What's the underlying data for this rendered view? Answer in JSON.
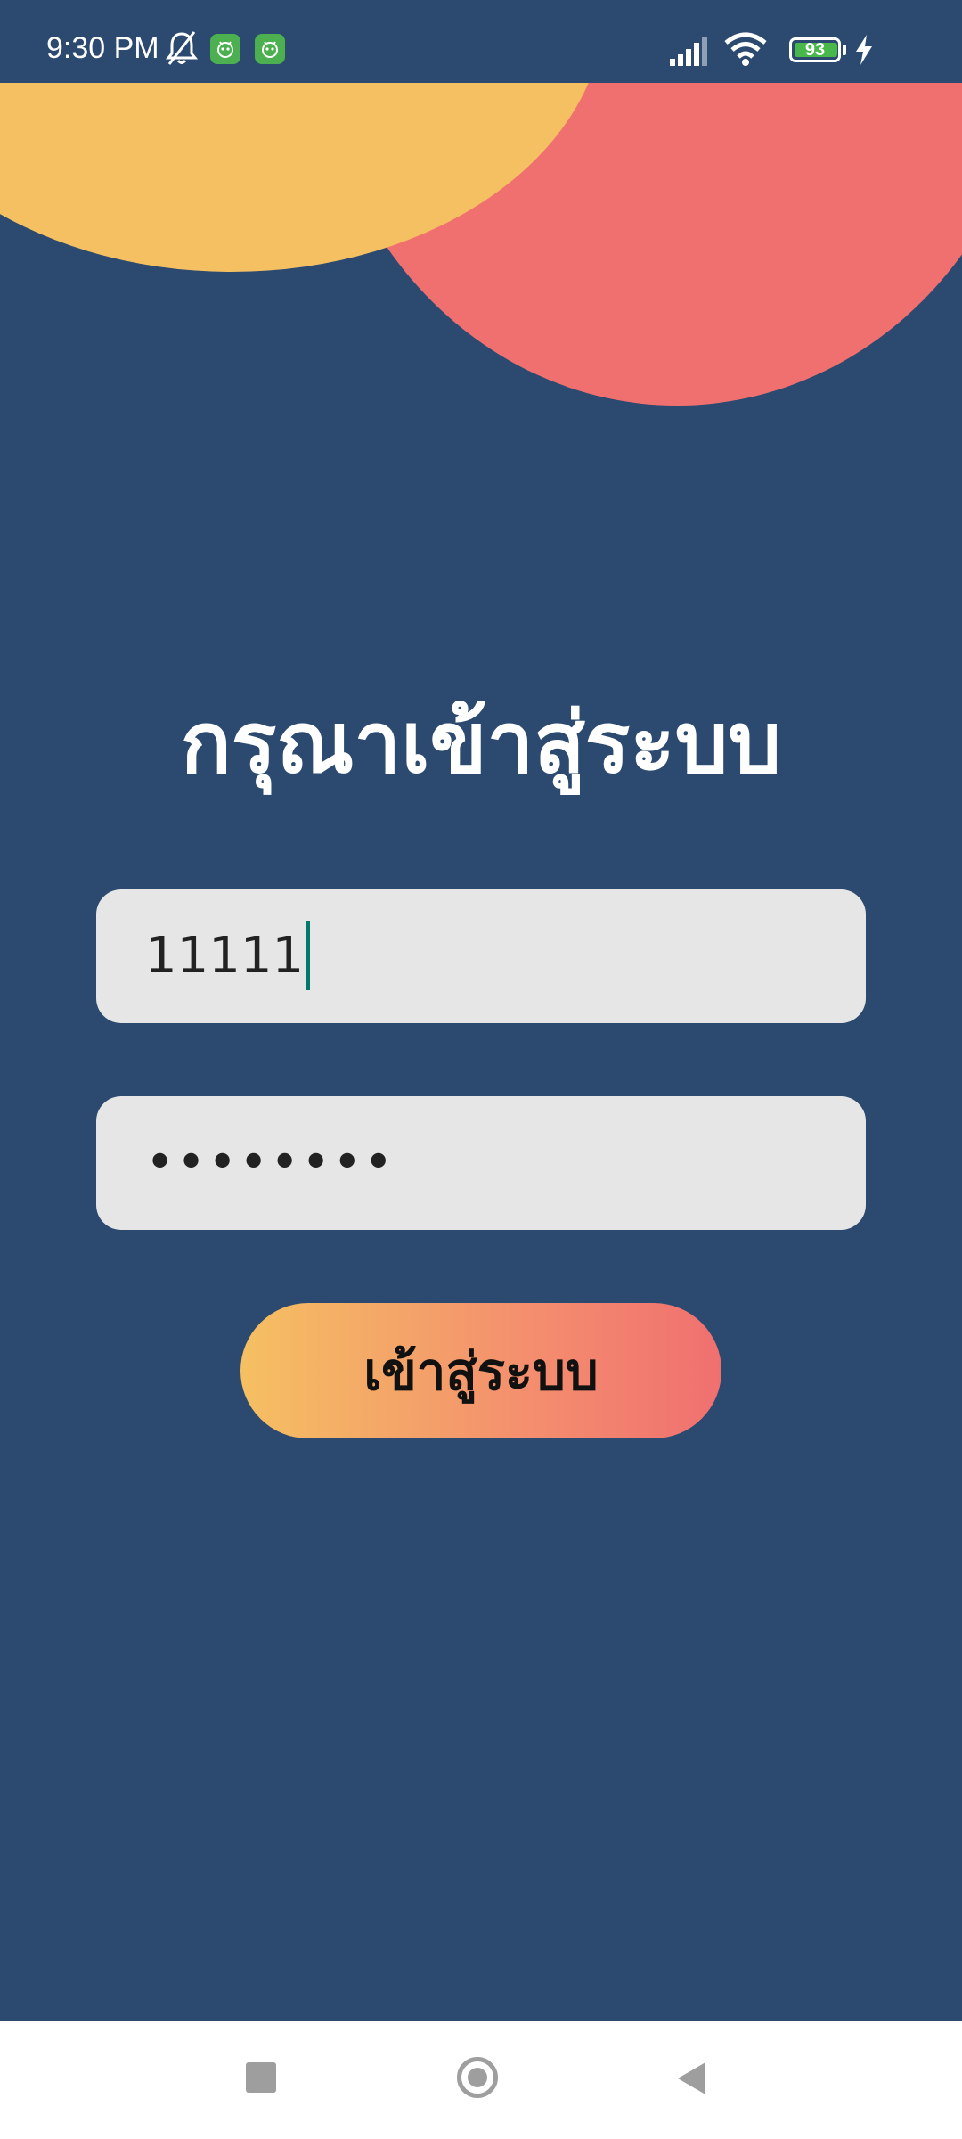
{
  "status_bar": {
    "time": "9:30 PM",
    "battery_level": "93",
    "icons": [
      "bell-muted-icon",
      "app-notification-icon",
      "app-notification-icon",
      "signal-icon",
      "wifi-icon",
      "battery-icon",
      "charging-icon"
    ]
  },
  "login": {
    "title": "กรุณาเข้าสู่ระบบ",
    "username_value": "11111",
    "password_value": "••••••••",
    "login_button_label": "เข้าสู่ระบบ"
  },
  "colors": {
    "background": "#2c4a6f",
    "circle_yellow": "#f5c062",
    "circle_coral": "#f07070",
    "field_background": "#e6e6e6",
    "caret": "#00796b"
  },
  "nav_bar": {
    "buttons": [
      "recent-apps-icon",
      "home-icon",
      "back-icon"
    ]
  }
}
